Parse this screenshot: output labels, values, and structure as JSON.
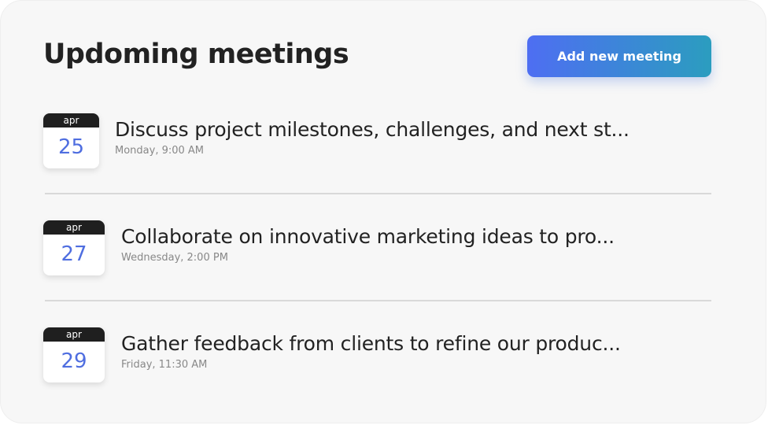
{
  "header": {
    "title": "Updoming meetings",
    "add_button_label": "Add new meeting"
  },
  "meetings": [
    {
      "month": "apr",
      "day": "25",
      "title": "Discuss project milestones, challenges, and next st...",
      "time": "Monday, 9:00 AM"
    },
    {
      "month": "apr",
      "day": "27",
      "title": "Collaborate on innovative marketing ideas to pro...",
      "time": "Wednesday, 2:00 PM"
    },
    {
      "month": "apr",
      "day": "29",
      "title": "Gather feedback from clients to refine our produc...",
      "time": "Friday, 11:30 AM"
    }
  ],
  "colors": {
    "accent_start": "#4e6ef2",
    "accent_end": "#2b9dbf",
    "day_number": "#4f6ee0",
    "month_band": "#1f1f1f"
  }
}
